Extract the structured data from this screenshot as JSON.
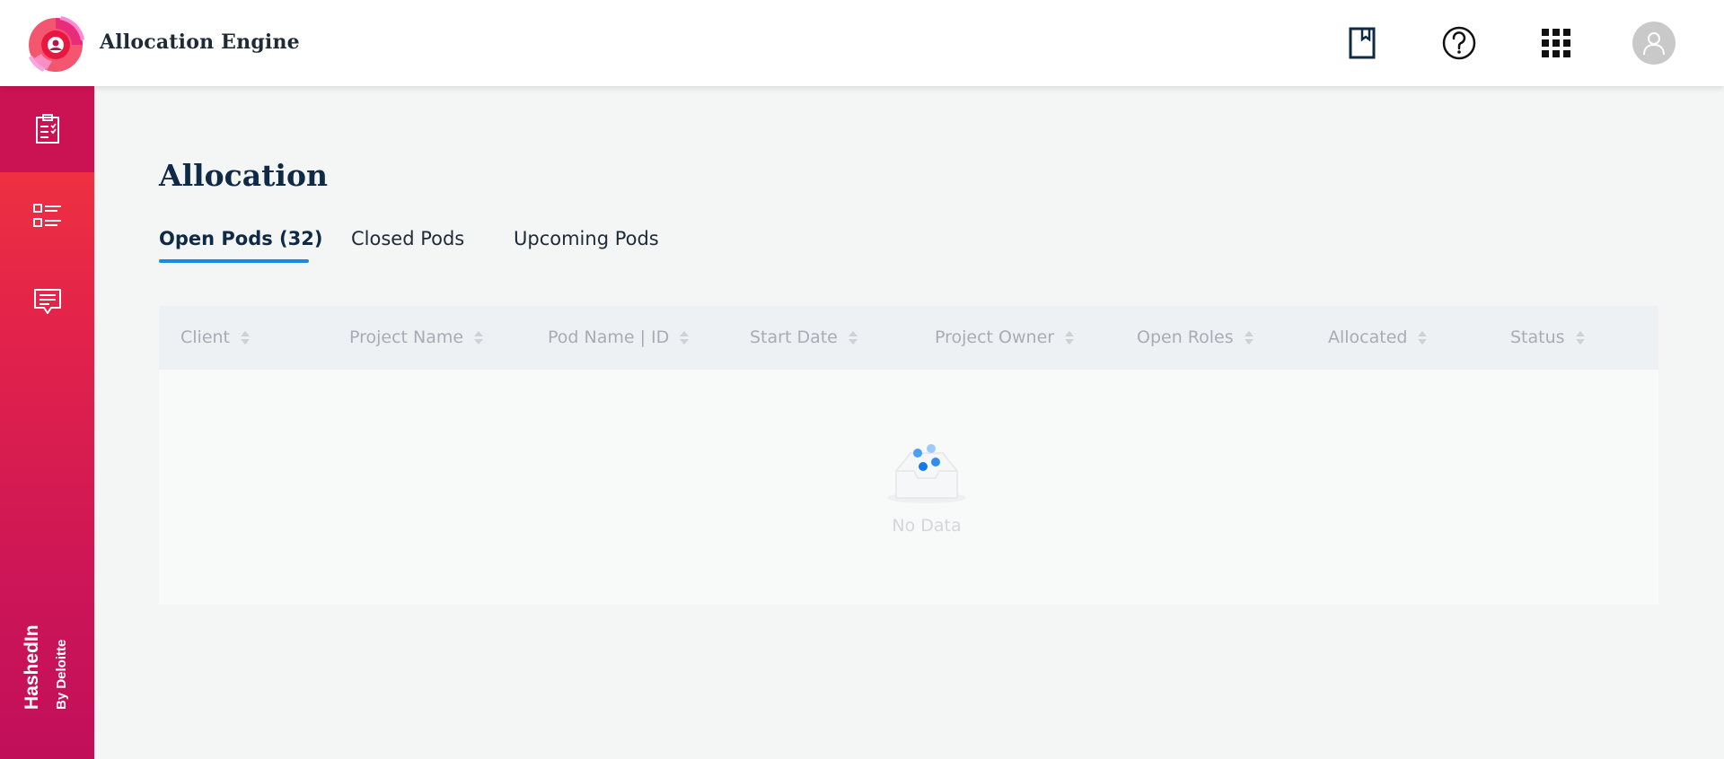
{
  "header": {
    "app_title": "Allocation Engine",
    "icons": [
      "bookmark-icon",
      "help-icon",
      "apps-grid-icon",
      "user-avatar-icon"
    ]
  },
  "sidebar": {
    "items": [
      {
        "icon": "clipboard-checklist-icon"
      },
      {
        "icon": "checklist-icon"
      },
      {
        "icon": "message-icon"
      }
    ],
    "brand_main": "HashedIn",
    "brand_sub": "By Deloitte"
  },
  "main": {
    "title": "Allocation",
    "tabs": [
      {
        "label": "Open Pods (32)",
        "active": true
      },
      {
        "label": "Closed Pods",
        "active": false
      },
      {
        "label": "Upcoming Pods",
        "active": false
      }
    ],
    "table": {
      "columns": [
        "Client",
        "Project Name",
        "Pod Name | ID",
        "Start Date",
        "Project Owner",
        "Open Roles",
        "Allocated",
        "Status"
      ],
      "empty_text": "No Data"
    }
  },
  "colors": {
    "accent": "#1b8ae6",
    "title": "#0e2a47",
    "sidebar_top": "#f4383e",
    "sidebar_bottom": "#c20f5a"
  }
}
